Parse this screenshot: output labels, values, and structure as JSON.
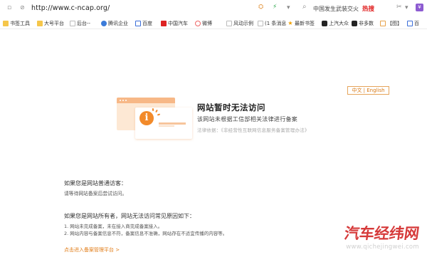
{
  "address_bar": {
    "url": "http://www.c-ncap.org/",
    "search_text": "中国发生武装交火",
    "hot_label": "热搜"
  },
  "bookmarks": [
    {
      "label": "书签工具",
      "icon": "folder"
    },
    {
      "label": "大号平台",
      "icon": "folder"
    },
    {
      "label": "后台--",
      "icon": "blank"
    },
    {
      "label": "腾讯企业",
      "icon": "tq"
    },
    {
      "label": "百度",
      "icon": "bd"
    },
    {
      "label": "中国汽车",
      "icon": "cn"
    },
    {
      "label": "微博",
      "icon": "wb"
    },
    {
      "label": "风动示例",
      "icon": "blank"
    },
    {
      "label": "(1 条消息)",
      "icon": "blank"
    },
    {
      "label": "最新书签",
      "icon": "star"
    },
    {
      "label": "上汽大众",
      "icon": "sh"
    },
    {
      "label": "非多数",
      "icon": "sh"
    },
    {
      "label": "【图】",
      "icon": "ex"
    },
    {
      "label": "百",
      "icon": "bd"
    }
  ],
  "lang_switch": "中文 | English",
  "notice": {
    "headline": "网站暂时无法访问",
    "sub": "该网站未根据工信部相关法律进行备案",
    "basis": "法律依据：《非经营性互联网信息服务备案管理办法》"
  },
  "visitor": {
    "title": "如果您是网站普通访客：",
    "text": "请等待网站备案后尝试访问。"
  },
  "owner": {
    "title": "如果您是网站所有者，网站无法访问常见原因如下：",
    "reasons": [
      "1. 网站未完成备案，未在接入商完成备案接入。",
      "2. 网站内容与备案信息不符，备案信息不准确，网站存在不适宜传播的内容等。"
    ],
    "link": "点击进入备案管理平台 >"
  },
  "watermark": {
    "main": "汽车经纬网",
    "sub": "www.qichejingwei.com"
  },
  "colors": {
    "accent": "#f28a2a",
    "link": "#e17c17",
    "watermark": "#d63a3a"
  }
}
